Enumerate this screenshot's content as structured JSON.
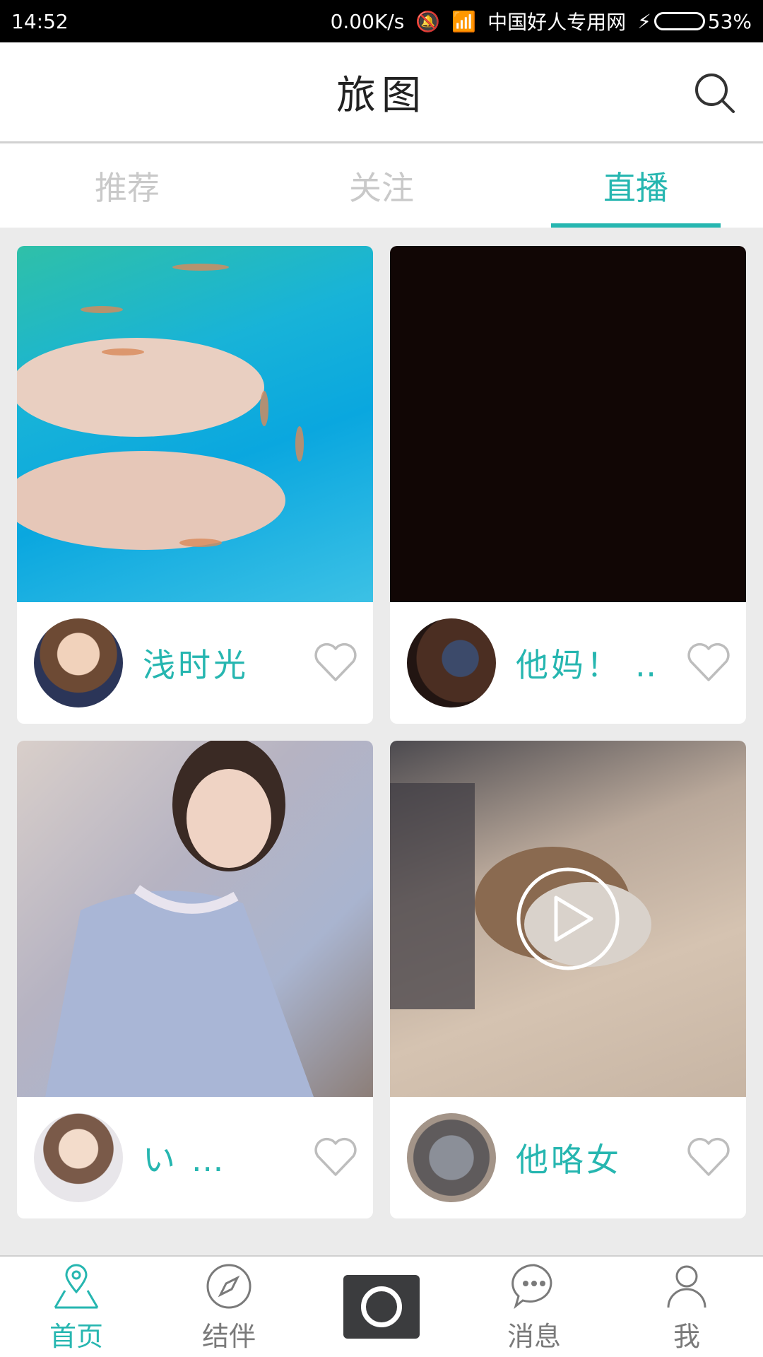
{
  "status_bar": {
    "time": "14:52",
    "speed": "0.00K/s",
    "carrier": "中国好人专用网",
    "battery": "53%",
    "battery_level": 0.53
  },
  "header": {
    "title": "旅图",
    "search_icon": "search-icon"
  },
  "tabs": [
    {
      "label": "推荐",
      "active": false
    },
    {
      "label": "关注",
      "active": false
    },
    {
      "label": "直播",
      "active": true
    }
  ],
  "cards": [
    {
      "name": "浅时光",
      "thumb": "fish-spa-photo",
      "avatar": "user-avatar-1"
    },
    {
      "name": "他妈！ …",
      "thumb": "dark-photo",
      "avatar": "user-avatar-2"
    },
    {
      "name": "い      …",
      "thumb": "selfie-photo",
      "avatar": "user-avatar-3"
    },
    {
      "name": "他咯女",
      "thumb": "dog-video",
      "avatar": "user-avatar-4"
    }
  ],
  "bottom_nav": [
    {
      "label": "首页",
      "icon": "location-pin-icon",
      "active": true
    },
    {
      "label": "结伴",
      "icon": "compass-icon",
      "active": false
    },
    {
      "label": "",
      "icon": "camera-button",
      "active": false
    },
    {
      "label": "消息",
      "icon": "chat-bubble-icon",
      "active": false
    },
    {
      "label": "我",
      "icon": "person-icon",
      "active": false
    }
  ],
  "colors": {
    "accent": "#26b6b0",
    "inactive_tab": "#c9c9c9",
    "background": "#ebebeb"
  }
}
